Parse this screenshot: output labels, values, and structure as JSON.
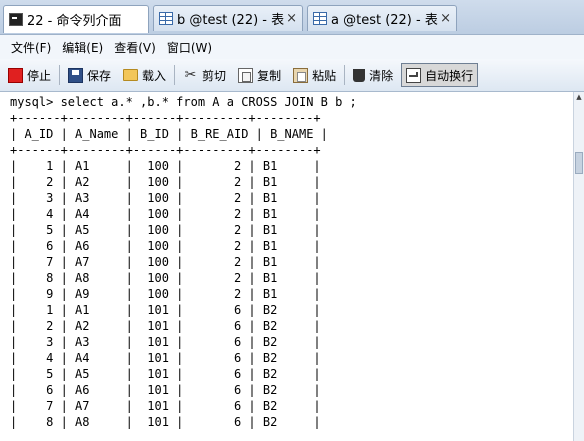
{
  "tabs": [
    {
      "label": "22 - 命令列介面",
      "icon": "terminal-icon",
      "active": true
    },
    {
      "label": "b @test (22) - 表",
      "icon": "table-icon",
      "active": false
    },
    {
      "label": "a @test (22) - 表",
      "icon": "table-icon",
      "active": false
    }
  ],
  "close_glyph": "×",
  "menu": [
    "文件(F)",
    "编辑(E)",
    "查看(V)",
    "窗口(W)"
  ],
  "toolbar": {
    "stop": "停止",
    "save": "保存",
    "load": "载入",
    "cut": "剪切",
    "copy": "复制",
    "paste": "粘贴",
    "clear": "清除",
    "wrap": "自动换行"
  },
  "console": {
    "prompt": "mysql> select a.* ,b.* from A a CROSS JOIN B b ;",
    "border": "+------+--------+------+---------+--------+",
    "header": "| A_ID | A_Name | B_ID | B_RE_AID | B_NAME |",
    "columns": [
      "A_ID",
      "A_Name",
      "B_ID",
      "B_RE_AID",
      "B_NAME"
    ],
    "rows": [
      [
        "1",
        "A1",
        "100",
        "2",
        "B1"
      ],
      [
        "2",
        "A2",
        "100",
        "2",
        "B1"
      ],
      [
        "3",
        "A3",
        "100",
        "2",
        "B1"
      ],
      [
        "4",
        "A4",
        "100",
        "2",
        "B1"
      ],
      [
        "5",
        "A5",
        "100",
        "2",
        "B1"
      ],
      [
        "6",
        "A6",
        "100",
        "2",
        "B1"
      ],
      [
        "7",
        "A7",
        "100",
        "2",
        "B1"
      ],
      [
        "8",
        "A8",
        "100",
        "2",
        "B1"
      ],
      [
        "9",
        "A9",
        "100",
        "2",
        "B1"
      ],
      [
        "1",
        "A1",
        "101",
        "6",
        "B2"
      ],
      [
        "2",
        "A2",
        "101",
        "6",
        "B2"
      ],
      [
        "3",
        "A3",
        "101",
        "6",
        "B2"
      ],
      [
        "4",
        "A4",
        "101",
        "6",
        "B2"
      ],
      [
        "5",
        "A5",
        "101",
        "6",
        "B2"
      ],
      [
        "6",
        "A6",
        "101",
        "6",
        "B2"
      ],
      [
        "7",
        "A7",
        "101",
        "6",
        "B2"
      ],
      [
        "8",
        "A8",
        "101",
        "6",
        "B2"
      ]
    ]
  }
}
